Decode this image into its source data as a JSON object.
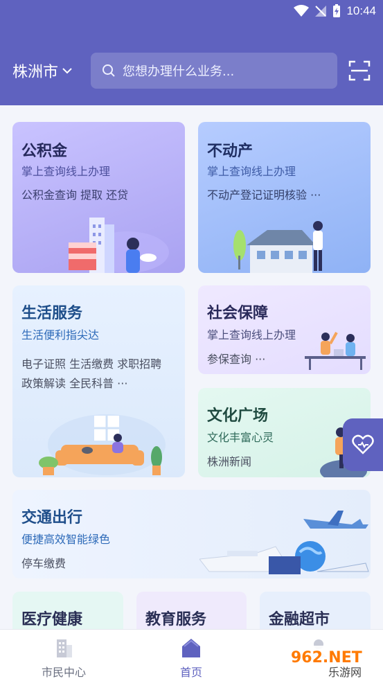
{
  "status": {
    "time": "10:44"
  },
  "header": {
    "city": "株洲市",
    "search_placeholder": "您想办理什么业务..."
  },
  "cards": {
    "gjj": {
      "title": "公积金",
      "subtitle": "掌上查询线上办理",
      "items": "公积金查询  提取  还贷"
    },
    "bdc": {
      "title": "不动产",
      "subtitle": "掌上查询线上办理",
      "items": "不动产登记证明核验  ···"
    },
    "shfw": {
      "title": "生活服务",
      "subtitle": "生活便利指尖达",
      "items_line1": "电子证照  生活缴费  求职招聘",
      "items_line2": "政策解读  全民科普  ···"
    },
    "shbz": {
      "title": "社会保障",
      "subtitle": "掌上查询线上办理",
      "items": "参保查询  ···"
    },
    "whgc": {
      "title": "文化广场",
      "subtitle": "文化丰富心灵",
      "items": "株洲新闻"
    },
    "jtcx": {
      "title": "交通出行",
      "subtitle": "便捷高效智能绿色",
      "items": "停车缴费"
    }
  },
  "mini_cards": [
    {
      "title": "医疗健康"
    },
    {
      "title": "教育服务"
    },
    {
      "title": "金融超市"
    }
  ],
  "bottom_nav": [
    {
      "label": "市民中心"
    },
    {
      "label": "首页"
    }
  ],
  "watermark": {
    "text": "962.NET",
    "sub": "乐游网"
  },
  "colors": {
    "primary": "#5f62bf",
    "watermark": "#ff7a00"
  }
}
